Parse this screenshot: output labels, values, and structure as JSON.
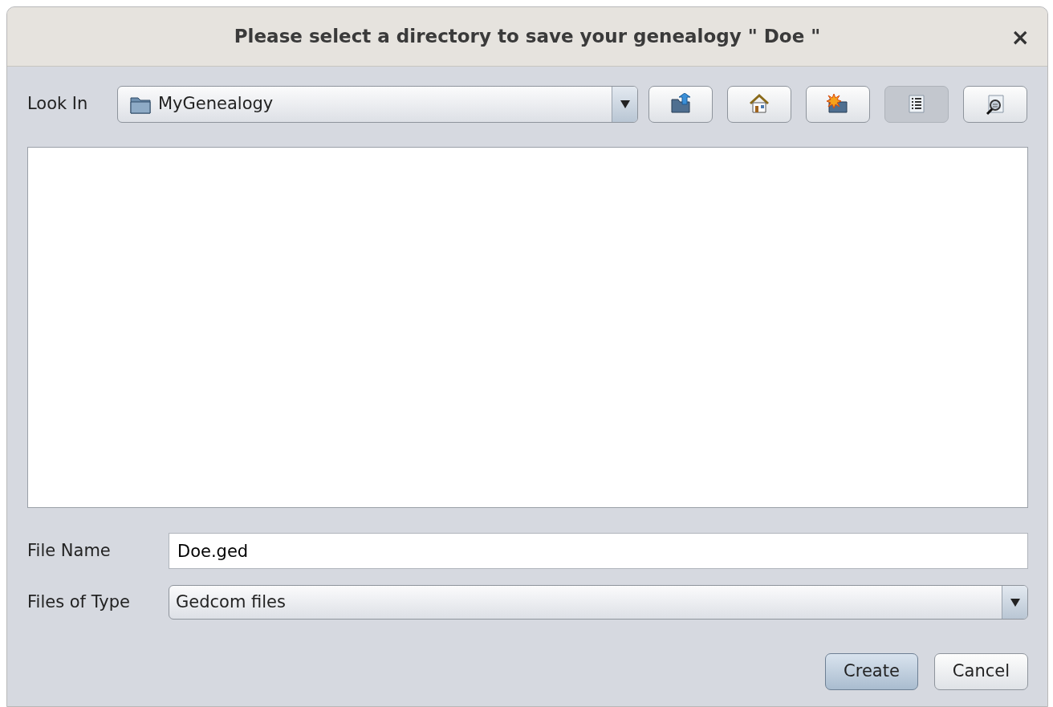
{
  "window": {
    "title": "Please select a directory to save your genealogy \" Doe \"",
    "close": "×"
  },
  "look_in": {
    "label": "Look In",
    "value": "MyGenealogy"
  },
  "toolbar": [
    {
      "kind": "up",
      "selected": false
    },
    {
      "kind": "home",
      "selected": false
    },
    {
      "kind": "new-folder",
      "selected": false
    },
    {
      "kind": "list",
      "selected": true
    },
    {
      "kind": "details",
      "selected": false
    }
  ],
  "file_name": {
    "label": "File Name",
    "value": "Doe.ged"
  },
  "file_type": {
    "label": "Files of Type",
    "value": "Gedcom files"
  },
  "buttons": [
    {
      "label": "Create",
      "default": true
    },
    {
      "label": "Cancel",
      "default": false
    }
  ]
}
